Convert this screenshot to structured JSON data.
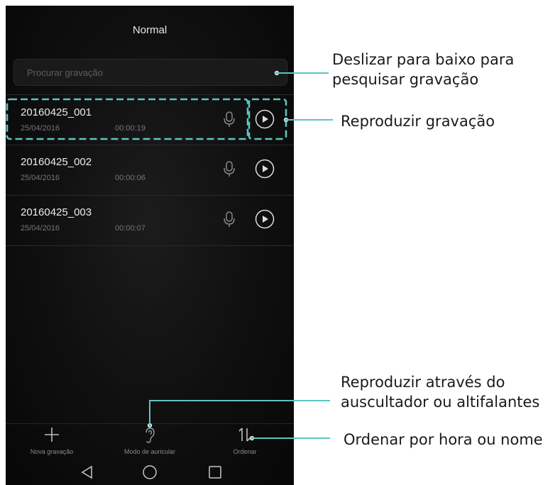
{
  "header": {
    "title": "Normal"
  },
  "search": {
    "placeholder": "Procurar gravação"
  },
  "recordings": [
    {
      "name": "20160425_001",
      "date": "25/04/2016",
      "duration": "00:00:19"
    },
    {
      "name": "20160425_002",
      "date": "25/04/2016",
      "duration": "00:00:06"
    },
    {
      "name": "20160425_003",
      "date": "25/04/2016",
      "duration": "00:00:07"
    }
  ],
  "toolbar": {
    "new_label": "Nova gravação",
    "earpiece_label": "Modo de auricular",
    "sort_label": "Ordenar"
  },
  "annotations": {
    "search_line1": "Deslizar para baixo para",
    "search_line2": "pesquisar gravação",
    "play": "Reproduzir gravação",
    "earpiece_line1": "Reproduzir através do",
    "earpiece_line2": "auscultador ou altifalantes",
    "sort": "Ordenar por hora ou nome"
  },
  "colors": {
    "accent": "#5fc4c0",
    "background": "#0f0f0f"
  },
  "icons": {
    "play": "play-circle-icon",
    "mic": "microphone-icon",
    "add": "plus-icon",
    "earpiece": "ear-icon",
    "sort": "sort-arrows-icon",
    "back": "back-triangle-icon",
    "home": "home-circle-icon",
    "recents": "recents-square-icon"
  }
}
